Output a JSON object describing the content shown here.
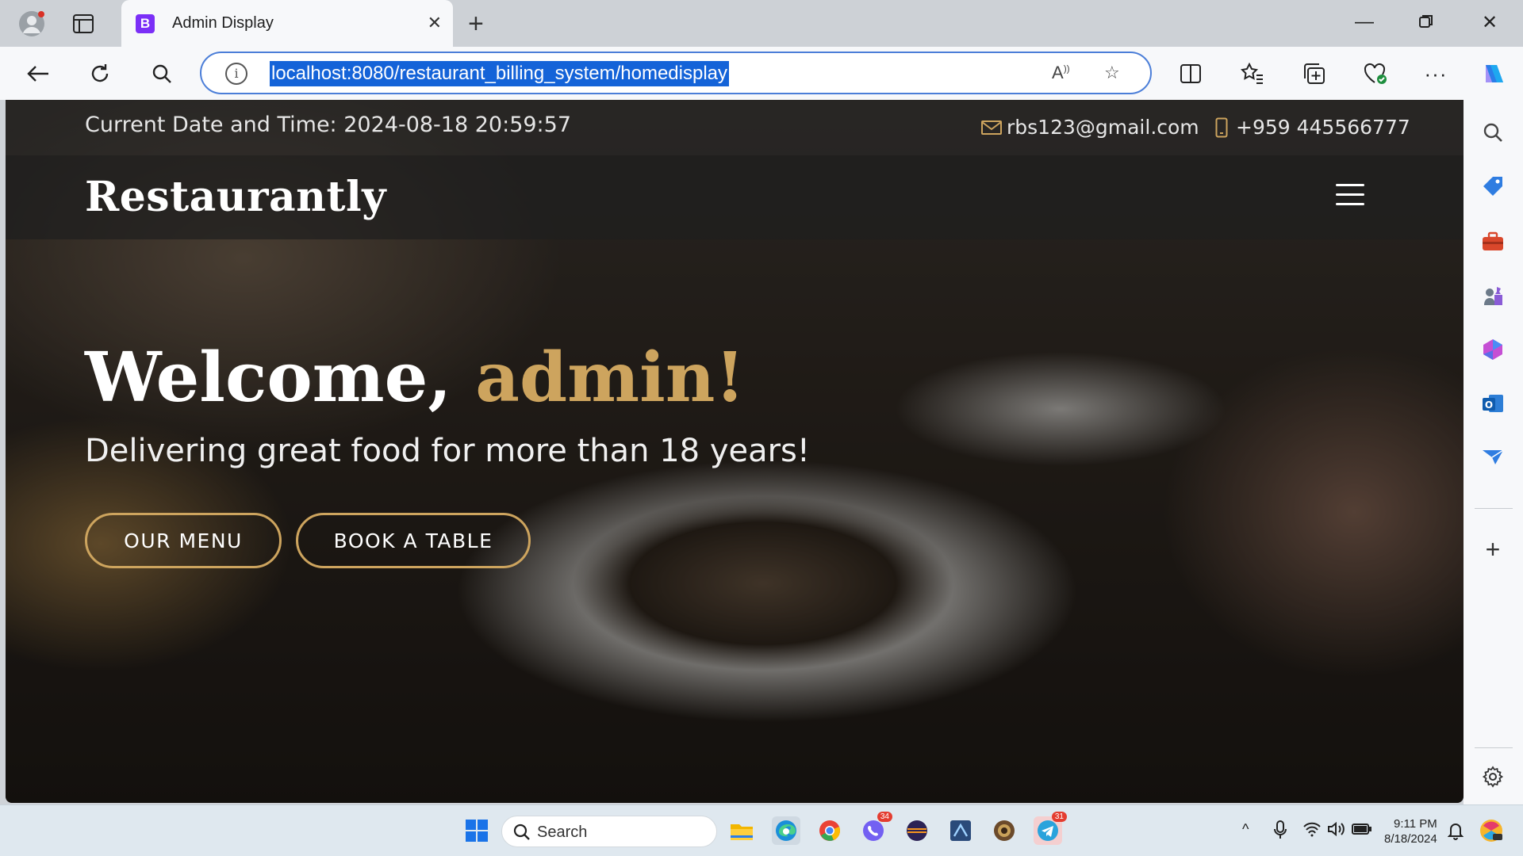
{
  "browser": {
    "tab_title": "Admin Display",
    "tab_favicon_letter": "B",
    "url": "localhost:8080/restaurant_billing_system/homedisplay"
  },
  "page": {
    "datetime": "Current Date and Time: 2024-08-18 20:59:57",
    "email": "rbs123@gmail.com",
    "phone": "+959 445566777",
    "brand": "Restaurantly",
    "welcome_prefix": "Welcome,",
    "welcome_name": "admin!",
    "tagline": "Delivering great food for more than 18 years!",
    "btn_menu": "OUR MENU",
    "btn_book": "BOOK A TABLE",
    "accent_color": "#cda45e"
  },
  "taskbar": {
    "search_label": "Search",
    "time": "9:11 PM",
    "date": "8/18/2024",
    "viber_badge": "34",
    "telegram_badge": "31"
  }
}
